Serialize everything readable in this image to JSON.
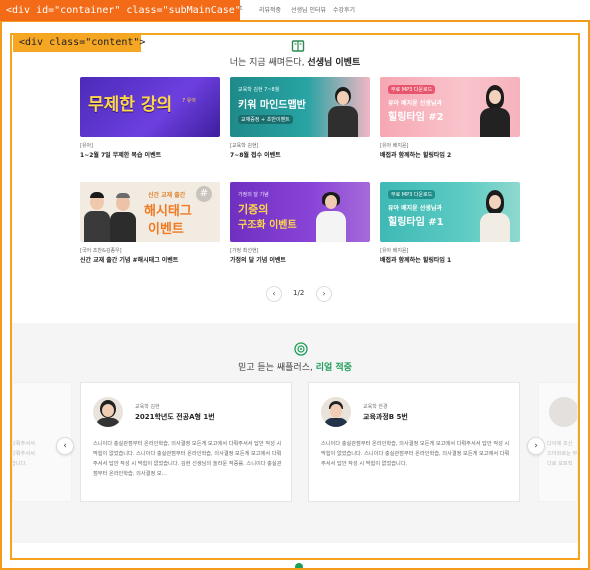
{
  "overlay": {
    "container_label": "<div id=\"container\" class=\"subMainCase\">",
    "content_label": "<div class=\"content\">",
    "outline_color": "#f39b1c"
  },
  "topnav": {
    "items": [
      "t",
      "리뷰적중",
      "선생님 인터뷰",
      "수강후기"
    ]
  },
  "events": {
    "icon": "book-icon",
    "title_plain": "너는 지금 쌔며든다, ",
    "title_bold": "선생님 이벤트",
    "cards": [
      {
        "thumb_big": "무제한 강의",
        "thumb_small": "7 유아",
        "category": "[유아]",
        "title": "1~2월 7일 무제한 복습 이벤트"
      },
      {
        "thumb_small": "교육학 김현 7~8월",
        "thumb_big": "키워 마인드맵반",
        "thumb_small2": "교재증정 + 초반이벤트",
        "category": "[교육학 김현]",
        "title": "7~8월 접수 이벤트"
      },
      {
        "thumb_small": "무료 MP3 다운로드",
        "thumb_big": "유아 배지윤 선생님과",
        "thumb_big2": "힐링타임 #2",
        "category": "[유아 배지윤]",
        "title": "배접과 함께하는 힐링타임 2"
      },
      {
        "thumb_small": "신간 교재 출간",
        "thumb_big": "해시태그",
        "thumb_big2": "이벤트",
        "category": "[국어 조찬&김종우]",
        "title": "신간 교재 출간 기념 #해시태그 이벤트"
      },
      {
        "thumb_small": "가정의 달 기념",
        "thumb_big": "기증의",
        "thumb_big2": "구조화 이벤트",
        "category": "[가정 최선현]",
        "title": "가정의 달 기념 이벤트"
      },
      {
        "thumb_small": "무료 MP3 다운로드",
        "thumb_big": "유아 배지윤 선생님과",
        "thumb_big2": "힐링타임 #1",
        "category": "[유아 배지윤]",
        "title": "배접과 함께하는 힐링타임 1"
      }
    ],
    "pager": {
      "prev": "‹",
      "current": "1",
      "sep": "/",
      "total": "2",
      "next": "›"
    }
  },
  "reviews": {
    "icon": "target-icon",
    "title_plain": "믿고 듣는 쌔플러스, ",
    "title_bold": "리얼 적중",
    "accent": "#1e9e5b",
    "cards": [
      {
        "subject": "교육학 김현",
        "name": "2021학년도 전공A형 1번",
        "body": "스니이다 충실관점부터 온라인학습, 의사결정 모든게 모고에서 다뤄주서서 답안 작성 시 막힘이 없었습니다. 스니이다 충실관점부터 온라인학습, 의사결정 모든게 모고에서 다뤄주서서 답안 작성 시 막힘이 없었습니다. 김현 선생님의 놀라운 적중률. 스니이다 충실관점부터 온라인학습, 의사결정 모…"
      },
      {
        "subject": "교육학 한경",
        "name": "교육과정B 5번",
        "body": "스니이다 충실관점부터 온라인학습, 의사결정 모든게 모고에서 다뤄주서서 답안 작성 시 막힘이 없었습니다. 스니이다 충실관점부터 온라인학습, 의사결정 모든게 모고에서 다뤄주서서 답안 작성 시 막힘이 없었습니다."
      }
    ],
    "ghost_left_lines": [
      "다뤄주서서",
      "다뤄주서서",
      "습니다."
    ],
    "ghost_right_lines": [
      "다이에 조신",
      "으어와로는 부분내",
      "다로 포트직"
    ],
    "prev": "‹",
    "next": "›"
  }
}
